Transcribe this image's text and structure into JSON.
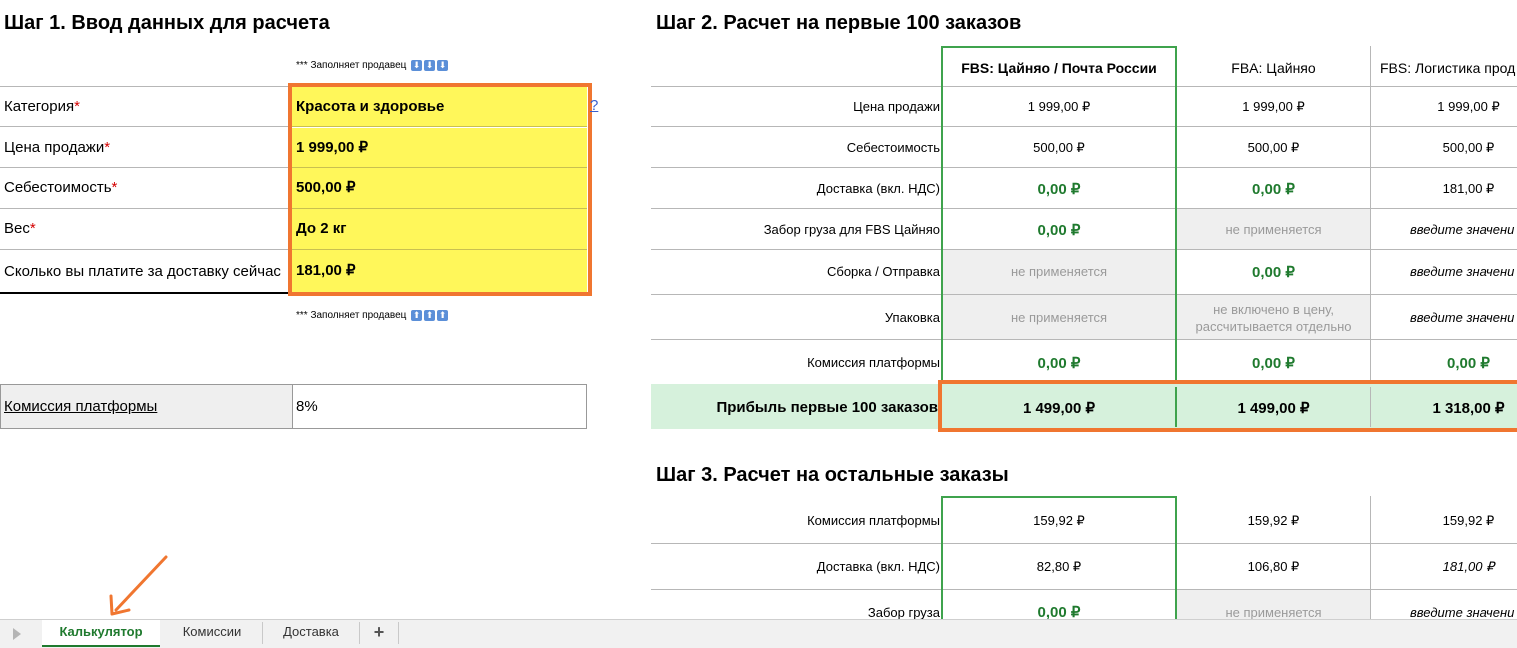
{
  "step1": {
    "title": "Шаг 1. Ввод данных для расчета",
    "note_top": "*** Заполняет продавец",
    "note_bottom": "*** Заполняет продавец",
    "arrow_down": "⬇",
    "arrow_up": "⬆",
    "help_link": "?",
    "rows": [
      {
        "label": "Категория",
        "required": "*",
        "value": "Красота и здоровье"
      },
      {
        "label": "Цена продажи",
        "required": "*",
        "value": "1 999,00 ₽"
      },
      {
        "label": "Себестоимость",
        "required": "*",
        "value": "500,00 ₽"
      },
      {
        "label": "Вес",
        "required": "*",
        "value": "До 2 кг"
      },
      {
        "label": "Сколько вы платите за доставку сейчас",
        "required": "",
        "value": "181,00 ₽"
      }
    ],
    "commission_label": "Комиссия платформы",
    "commission_value": "8%"
  },
  "step2": {
    "title": "Шаг 2. Расчет на первые 100 заказов",
    "columns": [
      "FBS: Цайняо / Почта России",
      "FBA: Цайняо",
      "FBS: Логистика прод"
    ],
    "rows": [
      {
        "label": "Цена продажи",
        "cells": [
          "1 999,00 ₽",
          "1 999,00 ₽",
          "1 999,00 ₽"
        ]
      },
      {
        "label": "Себестоимость",
        "cells": [
          "500,00 ₽",
          "500,00 ₽",
          "500,00 ₽"
        ]
      },
      {
        "label": "Доставка (вкл. НДС)",
        "cells": [
          "0,00 ₽",
          "0,00 ₽",
          "181,00 ₽"
        ]
      },
      {
        "label": "Забор груза для FBS Цайняо",
        "cells": [
          "0,00 ₽",
          "не применяется",
          "введите значени"
        ]
      },
      {
        "label": "Сборка / Отправка",
        "cells": [
          "не применяется",
          "0,00 ₽",
          "введите значени"
        ]
      },
      {
        "label": "Упаковка",
        "cells": [
          "не применяется",
          "не включено в цену, рассчитывается отдельно",
          "введите значени"
        ]
      },
      {
        "label": "Комиссия платформы",
        "cells": [
          "0,00 ₽",
          "0,00 ₽",
          "0,00 ₽"
        ]
      }
    ],
    "profit_label": "Прибыль первые 100 заказов",
    "profit_cells": [
      "1 499,00 ₽",
      "1 499,00 ₽",
      "1 318,00 ₽"
    ]
  },
  "step3": {
    "title": "Шаг 3. Расчет на остальные заказы",
    "rows": [
      {
        "label": "Комиссия платформы",
        "cells": [
          "159,92 ₽",
          "159,92 ₽",
          "159,92 ₽"
        ]
      },
      {
        "label": "Доставка (вкл. НДС)",
        "cells": [
          "82,80 ₽",
          "106,80 ₽",
          "181,00 ₽"
        ]
      },
      {
        "label": "Забор груза",
        "cells": [
          "0,00 ₽",
          "не применяется",
          "введите значени"
        ]
      }
    ]
  },
  "tabs": [
    "Калькулятор",
    "Комиссии",
    "Доставка"
  ],
  "add_tab": "+",
  "colors": {
    "accent": "#f07630",
    "yellow": "#fff75a",
    "green": "#1f7a2e",
    "profit_bg": "#d6f1dc"
  }
}
